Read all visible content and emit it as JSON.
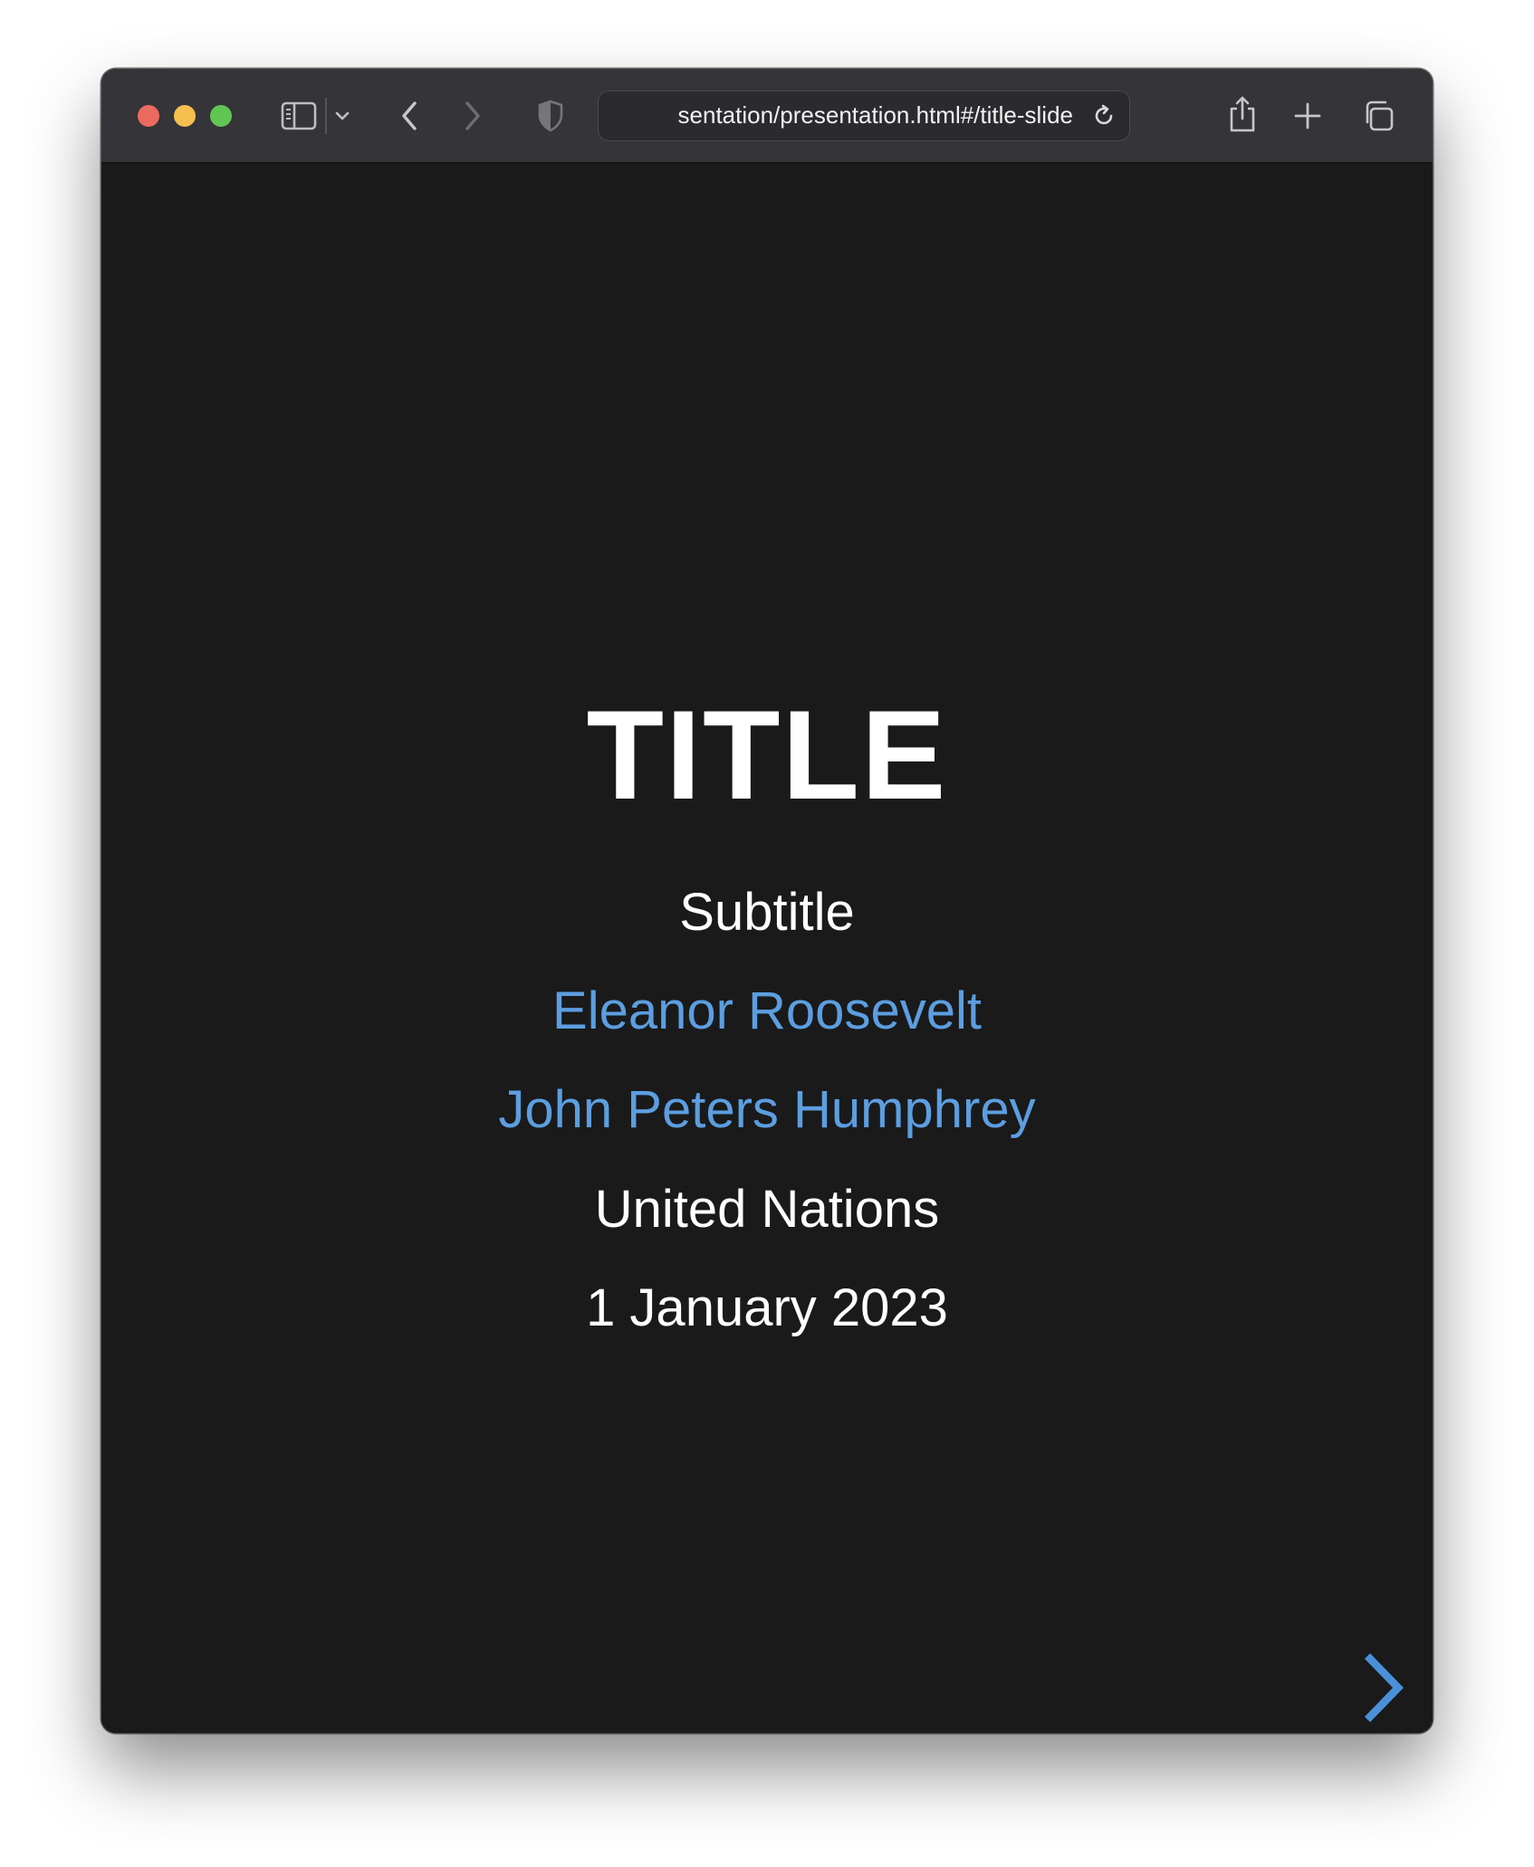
{
  "browser": {
    "url_text": "sentation/presentation.html#/title-slide",
    "icons": [
      "close-window",
      "minimize-window",
      "zoom-window",
      "sidebar-icon",
      "chevron-down-icon",
      "back-arrow-icon",
      "forward-arrow-icon",
      "privacy-shield-icon",
      "reload-icon",
      "share-icon",
      "new-tab-plus-icon",
      "tab-overview-icon"
    ]
  },
  "slide": {
    "title": "TITLE",
    "subtitle": "Subtitle",
    "authors": [
      "Eleanor Roosevelt",
      "John Peters Humphrey"
    ],
    "institute": "United Nations",
    "date": "1 January 2023",
    "next_icon": "chevron-right-icon"
  },
  "colors": {
    "slide_background": "#1a1a1b",
    "text": "#ffffff",
    "author_link": "#5c9ee0",
    "toolbar": "#353438"
  }
}
